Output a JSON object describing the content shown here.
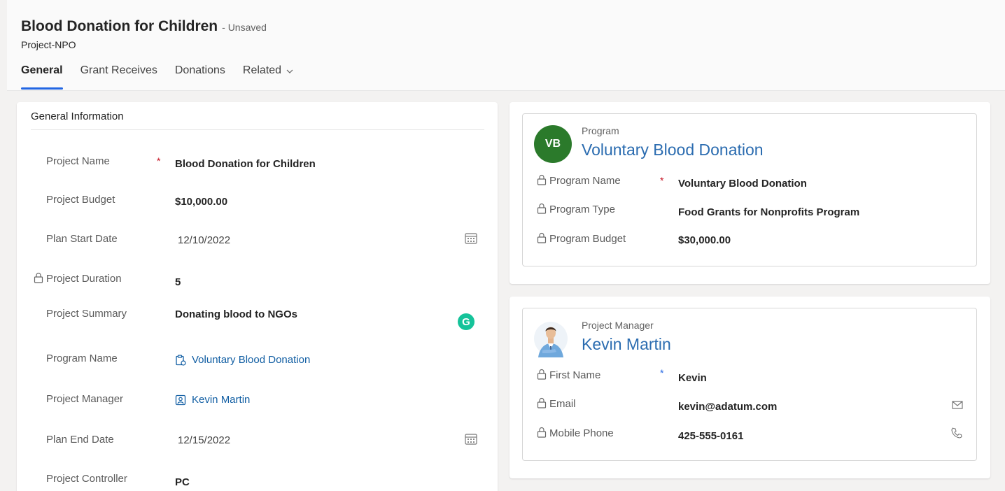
{
  "header": {
    "title": "Blood Donation for Children",
    "status": "- Unsaved",
    "entity": "Project-NPO"
  },
  "tabs": [
    {
      "label": "General",
      "active": true
    },
    {
      "label": "Grant Receives",
      "active": false
    },
    {
      "label": "Donations",
      "active": false
    },
    {
      "label": "Related",
      "active": false,
      "dropdown": true
    }
  ],
  "general": {
    "section_title": "General Information",
    "fields": {
      "project_name": {
        "label": "Project Name",
        "value": "Blood Donation for Children",
        "required_mark": "*"
      },
      "project_budget": {
        "label": "Project Budget",
        "value": "$10,000.00"
      },
      "plan_start_date": {
        "label": "Plan Start Date",
        "value": "12/10/2022"
      },
      "project_duration": {
        "label": "Project Duration",
        "value": "5"
      },
      "project_summary": {
        "label": "Project Summary",
        "value": "Donating blood to NGOs"
      },
      "program_name": {
        "label": "Program Name",
        "value": "Voluntary Blood Donation"
      },
      "project_manager": {
        "label": "Project Manager",
        "value": "Kevin Martin"
      },
      "plan_end_date": {
        "label": "Plan End Date",
        "value": "12/15/2022"
      },
      "project_controller": {
        "label": "Project Controller",
        "value": "PC"
      }
    },
    "grammarly_glyph": "G"
  },
  "program_card": {
    "type_label": "Program",
    "name": "Voluntary Blood Donation",
    "avatar_initials": "VB",
    "avatar_color": "#2b7a2b",
    "fields": {
      "program_name": {
        "label": "Program Name",
        "value": "Voluntary Blood Donation",
        "required_mark": "*"
      },
      "program_type": {
        "label": "Program Type",
        "value": "Food Grants for Nonprofits Program"
      },
      "program_budget": {
        "label": "Program Budget",
        "value": "$30,000.00"
      }
    }
  },
  "manager_card": {
    "type_label": "Project Manager",
    "name": "Kevin Martin",
    "fields": {
      "first_name": {
        "label": "First Name",
        "value": "Kevin",
        "required_mark": "*"
      },
      "email": {
        "label": "Email",
        "value": "kevin@adatum.com"
      },
      "mobile_phone": {
        "label": "Mobile Phone",
        "value": "425-555-0161"
      }
    }
  },
  "colors": {
    "accent": "#2266e3",
    "link": "#115ea3",
    "required": "#c50f1f",
    "grammarly": "#15c39a"
  },
  "icons": [
    "lock-icon",
    "calendar-icon",
    "grammarly-icon",
    "program-link-icon",
    "contact-link-icon",
    "email-icon",
    "phone-icon",
    "chevron-down-icon"
  ]
}
